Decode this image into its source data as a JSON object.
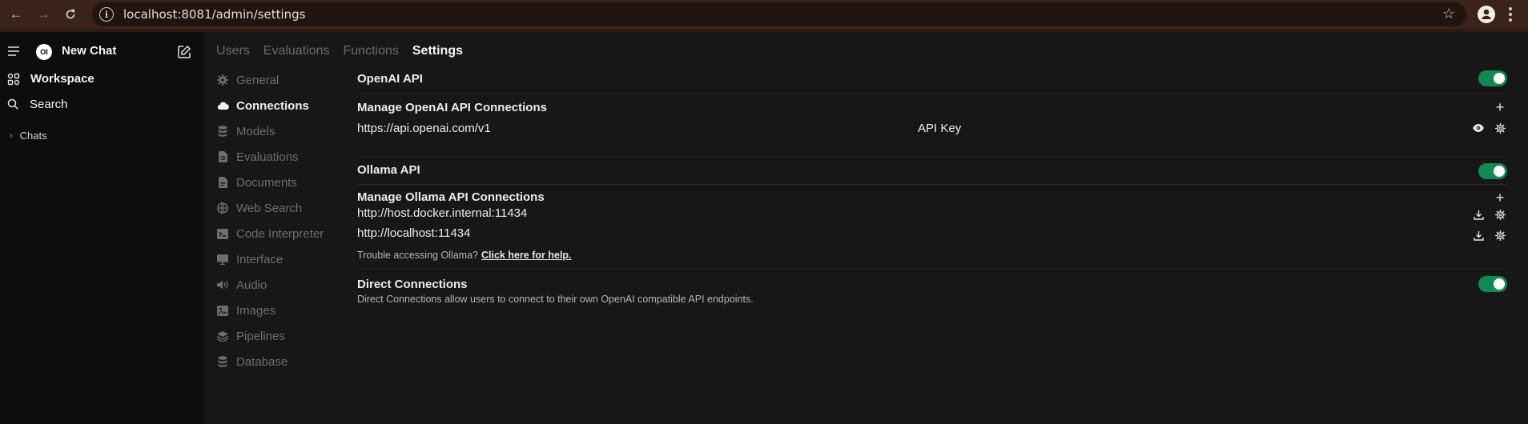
{
  "browser": {
    "url": "localhost:8081/admin/settings",
    "info_icon": "info-icon",
    "star_icon": "star-icon"
  },
  "sidebar": {
    "new_chat": "New Chat",
    "logo_text": "OI",
    "workspace": "Workspace",
    "search": "Search",
    "chats": "Chats"
  },
  "tabs": [
    {
      "label": "Users",
      "active": false
    },
    {
      "label": "Evaluations",
      "active": false
    },
    {
      "label": "Functions",
      "active": false
    },
    {
      "label": "Settings",
      "active": true
    }
  ],
  "settings_nav": [
    {
      "label": "General",
      "icon": "gear-icon"
    },
    {
      "label": "Connections",
      "icon": "cloud-icon",
      "active": true
    },
    {
      "label": "Models",
      "icon": "database-icon"
    },
    {
      "label": "Evaluations",
      "icon": "document-icon"
    },
    {
      "label": "Documents",
      "icon": "document-icon"
    },
    {
      "label": "Web Search",
      "icon": "globe-icon"
    },
    {
      "label": "Code Interpreter",
      "icon": "terminal-icon"
    },
    {
      "label": "Interface",
      "icon": "monitor-icon"
    },
    {
      "label": "Audio",
      "icon": "speaker-icon"
    },
    {
      "label": "Images",
      "icon": "image-icon"
    },
    {
      "label": "Pipelines",
      "icon": "stack-icon"
    },
    {
      "label": "Database",
      "icon": "database-icon"
    }
  ],
  "openai": {
    "title": "OpenAI API",
    "enabled": true,
    "manage_title": "Manage OpenAI API Connections",
    "url": "https://api.openai.com/v1",
    "key_label": "API Key"
  },
  "ollama": {
    "title": "Ollama API",
    "enabled": true,
    "manage_title": "Manage Ollama API Connections",
    "urls": [
      "http://host.docker.internal:11434",
      "http://localhost:11434"
    ],
    "help_text": "Trouble accessing Ollama?",
    "help_link": "Click here for help."
  },
  "direct": {
    "title": "Direct Connections",
    "enabled": true,
    "description": "Direct Connections allow users to connect to their own OpenAI compatible API endpoints."
  },
  "colors": {
    "toggle_on": "#0f8a55",
    "browser_bar": "#3a2318"
  }
}
